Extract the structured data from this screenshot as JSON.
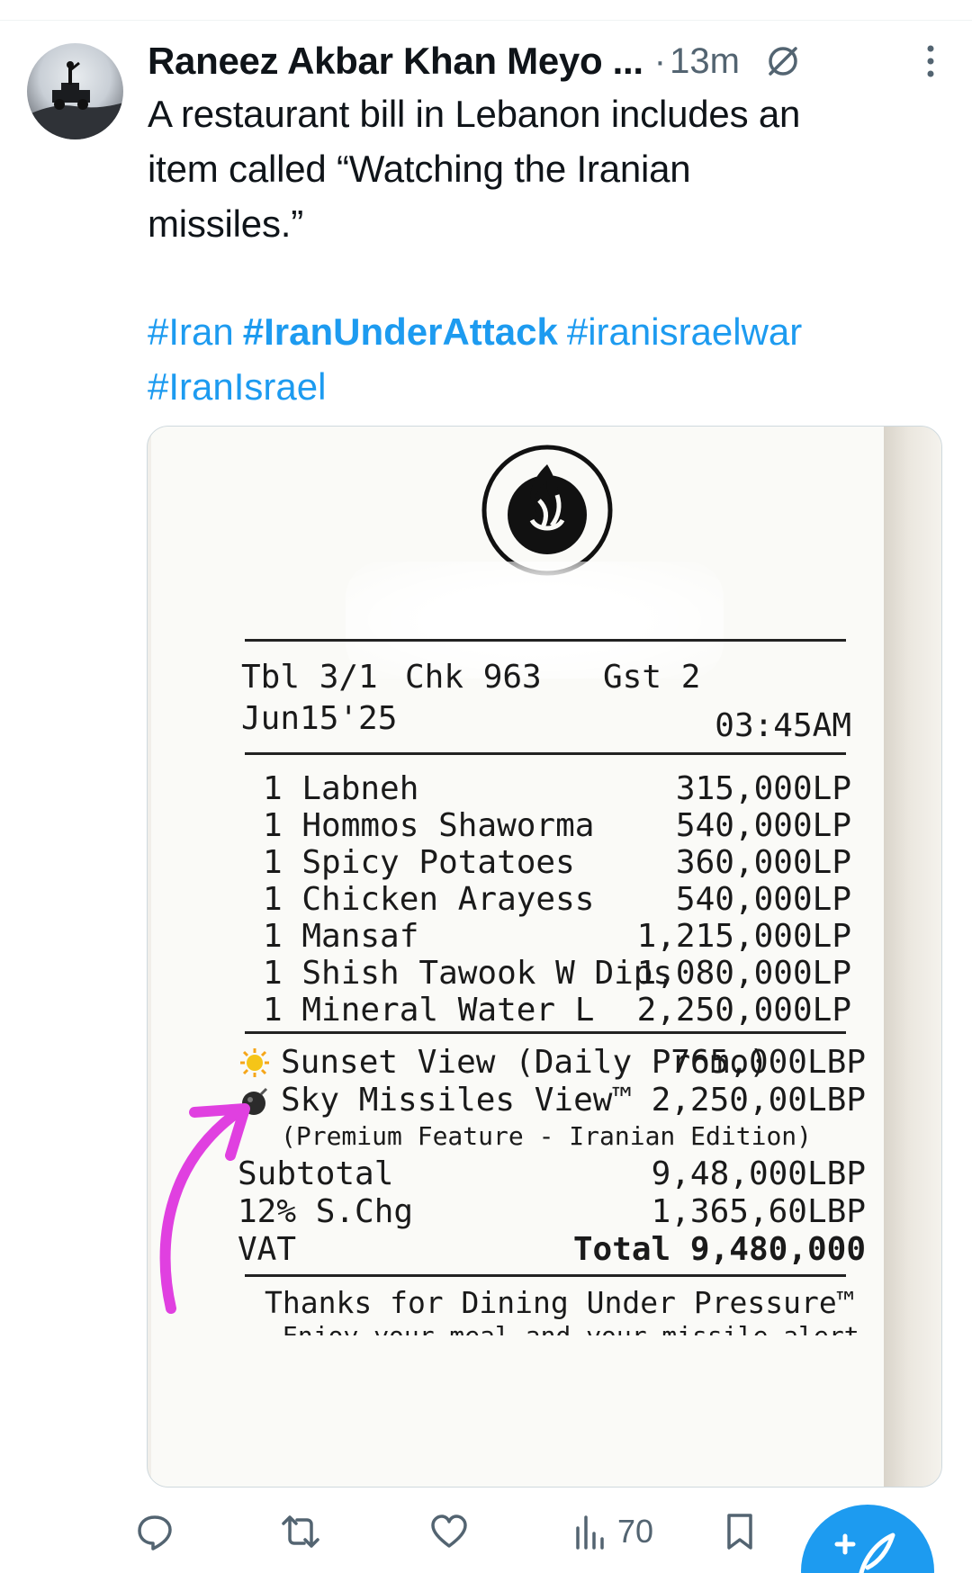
{
  "tweet": {
    "author": "Raneez Akbar Khan Meyo ...",
    "separator": "·",
    "time": "13m",
    "text_lines": [
      "A restaurant bill in Lebanon includes an",
      "item called “Watching the Iranian",
      "missiles.”"
    ],
    "hashtags": {
      "tag1": "#Iran",
      "tag2": "#IranUnderAttack",
      "tag3": "#iranisraelwar",
      "tag4": "#IranIsrael"
    }
  },
  "receipt": {
    "table": "Tbl 3/1",
    "check": "Chk 963",
    "guests": "Gst 2",
    "date": "Jun15'25",
    "time": "03:45AM",
    "items": [
      {
        "name": "1 Labneh",
        "price": "315,000LP"
      },
      {
        "name": "1 Hommos Shaworma",
        "price": "540,000LP"
      },
      {
        "name": "1 Spicy Potatoes",
        "price": "360,000LP"
      },
      {
        "name": "1 Chicken Arayess",
        "price": "540,000LP"
      },
      {
        "name": "1 Mansaf",
        "price": "1,215,000LP"
      },
      {
        "name": "1 Shish Tawook W Dips",
        "price": "1,080,000LP"
      },
      {
        "name": "1 Mineral Water L",
        "price": "2,250,000LP"
      }
    ],
    "promo1": {
      "name": "Sunset View (Daily Promo)",
      "price": "765,000LBP"
    },
    "promo2": {
      "name": "Sky Missiles View™",
      "price": "2,250,00LBP",
      "note": "(Premium Feature - Iranian Edition)"
    },
    "subtotal_label": "Subtotal",
    "subtotal_value": "9,48,000LBP",
    "schg_label": "12% S.Chg",
    "schg_value": "1,365,60LBP",
    "vat_label": "VAT",
    "total_label": "Total",
    "total_value": "9,480,000",
    "footer": "Thanks for Dining Under Pressure™",
    "footer2": "Enjoy your meal and your missile alert"
  },
  "actions": {
    "views": "70"
  },
  "colors": {
    "accent": "#1d9bf0",
    "muted": "#536471",
    "arrow": "#e040e0"
  }
}
